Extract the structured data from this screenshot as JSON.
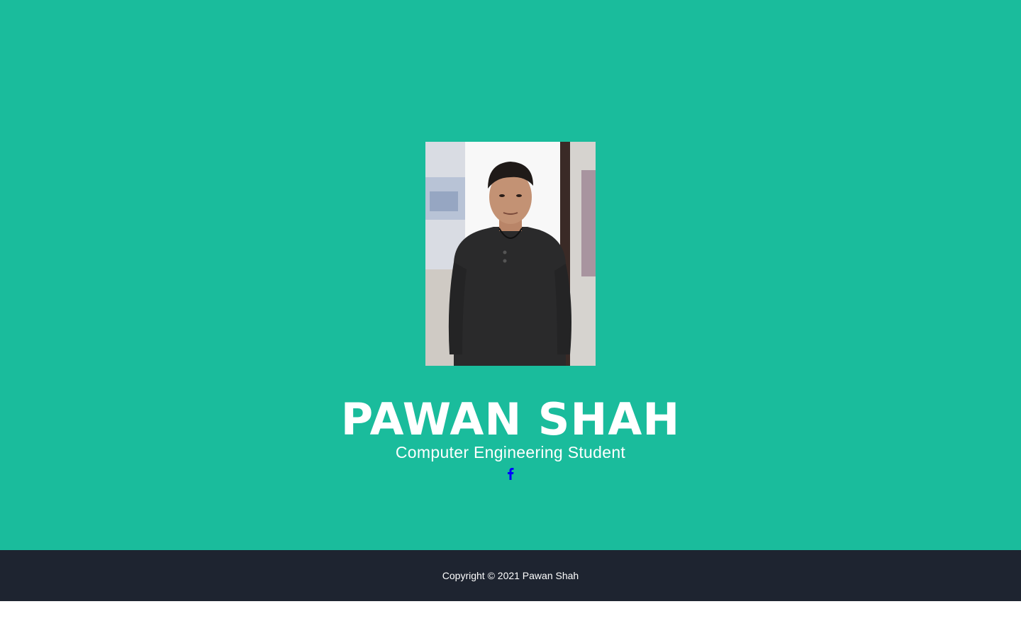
{
  "profile": {
    "name": "PAWAN SHAH",
    "subtitle": "Computer Engineering Student",
    "photo_alt": "Profile photo",
    "social": [
      {
        "icon": "facebook-icon",
        "color": "#0000ff"
      }
    ]
  },
  "footer": {
    "copyright": "Copyright © 2021 Pawan Shah"
  },
  "colors": {
    "hero_bg": "#1abc9c",
    "footer_bg": "#1e2430",
    "text": "#ffffff",
    "link": "#0000ff"
  }
}
